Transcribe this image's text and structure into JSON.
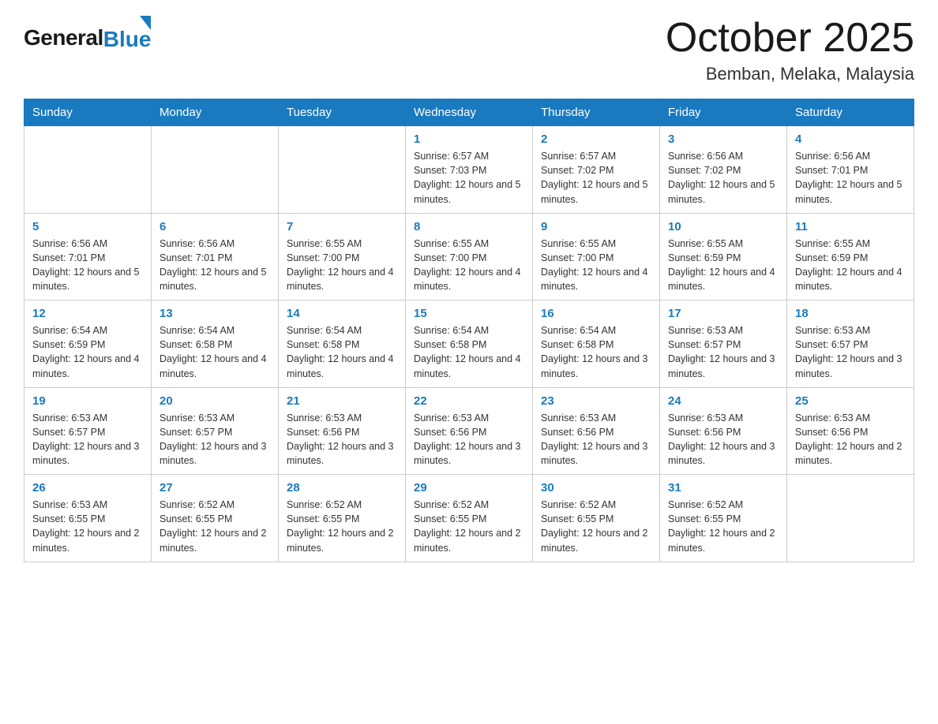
{
  "logo": {
    "general": "General",
    "blue": "Blue"
  },
  "title": "October 2025",
  "location": "Bemban, Melaka, Malaysia",
  "weekdays": [
    "Sunday",
    "Monday",
    "Tuesday",
    "Wednesday",
    "Thursday",
    "Friday",
    "Saturday"
  ],
  "weeks": [
    [
      {
        "day": "",
        "info": ""
      },
      {
        "day": "",
        "info": ""
      },
      {
        "day": "",
        "info": ""
      },
      {
        "day": "1",
        "info": "Sunrise: 6:57 AM\nSunset: 7:03 PM\nDaylight: 12 hours and 5 minutes."
      },
      {
        "day": "2",
        "info": "Sunrise: 6:57 AM\nSunset: 7:02 PM\nDaylight: 12 hours and 5 minutes."
      },
      {
        "day": "3",
        "info": "Sunrise: 6:56 AM\nSunset: 7:02 PM\nDaylight: 12 hours and 5 minutes."
      },
      {
        "day": "4",
        "info": "Sunrise: 6:56 AM\nSunset: 7:01 PM\nDaylight: 12 hours and 5 minutes."
      }
    ],
    [
      {
        "day": "5",
        "info": "Sunrise: 6:56 AM\nSunset: 7:01 PM\nDaylight: 12 hours and 5 minutes."
      },
      {
        "day": "6",
        "info": "Sunrise: 6:56 AM\nSunset: 7:01 PM\nDaylight: 12 hours and 5 minutes."
      },
      {
        "day": "7",
        "info": "Sunrise: 6:55 AM\nSunset: 7:00 PM\nDaylight: 12 hours and 4 minutes."
      },
      {
        "day": "8",
        "info": "Sunrise: 6:55 AM\nSunset: 7:00 PM\nDaylight: 12 hours and 4 minutes."
      },
      {
        "day": "9",
        "info": "Sunrise: 6:55 AM\nSunset: 7:00 PM\nDaylight: 12 hours and 4 minutes."
      },
      {
        "day": "10",
        "info": "Sunrise: 6:55 AM\nSunset: 6:59 PM\nDaylight: 12 hours and 4 minutes."
      },
      {
        "day": "11",
        "info": "Sunrise: 6:55 AM\nSunset: 6:59 PM\nDaylight: 12 hours and 4 minutes."
      }
    ],
    [
      {
        "day": "12",
        "info": "Sunrise: 6:54 AM\nSunset: 6:59 PM\nDaylight: 12 hours and 4 minutes."
      },
      {
        "day": "13",
        "info": "Sunrise: 6:54 AM\nSunset: 6:58 PM\nDaylight: 12 hours and 4 minutes."
      },
      {
        "day": "14",
        "info": "Sunrise: 6:54 AM\nSunset: 6:58 PM\nDaylight: 12 hours and 4 minutes."
      },
      {
        "day": "15",
        "info": "Sunrise: 6:54 AM\nSunset: 6:58 PM\nDaylight: 12 hours and 4 minutes."
      },
      {
        "day": "16",
        "info": "Sunrise: 6:54 AM\nSunset: 6:58 PM\nDaylight: 12 hours and 3 minutes."
      },
      {
        "day": "17",
        "info": "Sunrise: 6:53 AM\nSunset: 6:57 PM\nDaylight: 12 hours and 3 minutes."
      },
      {
        "day": "18",
        "info": "Sunrise: 6:53 AM\nSunset: 6:57 PM\nDaylight: 12 hours and 3 minutes."
      }
    ],
    [
      {
        "day": "19",
        "info": "Sunrise: 6:53 AM\nSunset: 6:57 PM\nDaylight: 12 hours and 3 minutes."
      },
      {
        "day": "20",
        "info": "Sunrise: 6:53 AM\nSunset: 6:57 PM\nDaylight: 12 hours and 3 minutes."
      },
      {
        "day": "21",
        "info": "Sunrise: 6:53 AM\nSunset: 6:56 PM\nDaylight: 12 hours and 3 minutes."
      },
      {
        "day": "22",
        "info": "Sunrise: 6:53 AM\nSunset: 6:56 PM\nDaylight: 12 hours and 3 minutes."
      },
      {
        "day": "23",
        "info": "Sunrise: 6:53 AM\nSunset: 6:56 PM\nDaylight: 12 hours and 3 minutes."
      },
      {
        "day": "24",
        "info": "Sunrise: 6:53 AM\nSunset: 6:56 PM\nDaylight: 12 hours and 3 minutes."
      },
      {
        "day": "25",
        "info": "Sunrise: 6:53 AM\nSunset: 6:56 PM\nDaylight: 12 hours and 2 minutes."
      }
    ],
    [
      {
        "day": "26",
        "info": "Sunrise: 6:53 AM\nSunset: 6:55 PM\nDaylight: 12 hours and 2 minutes."
      },
      {
        "day": "27",
        "info": "Sunrise: 6:52 AM\nSunset: 6:55 PM\nDaylight: 12 hours and 2 minutes."
      },
      {
        "day": "28",
        "info": "Sunrise: 6:52 AM\nSunset: 6:55 PM\nDaylight: 12 hours and 2 minutes."
      },
      {
        "day": "29",
        "info": "Sunrise: 6:52 AM\nSunset: 6:55 PM\nDaylight: 12 hours and 2 minutes."
      },
      {
        "day": "30",
        "info": "Sunrise: 6:52 AM\nSunset: 6:55 PM\nDaylight: 12 hours and 2 minutes."
      },
      {
        "day": "31",
        "info": "Sunrise: 6:52 AM\nSunset: 6:55 PM\nDaylight: 12 hours and 2 minutes."
      },
      {
        "day": "",
        "info": ""
      }
    ]
  ]
}
